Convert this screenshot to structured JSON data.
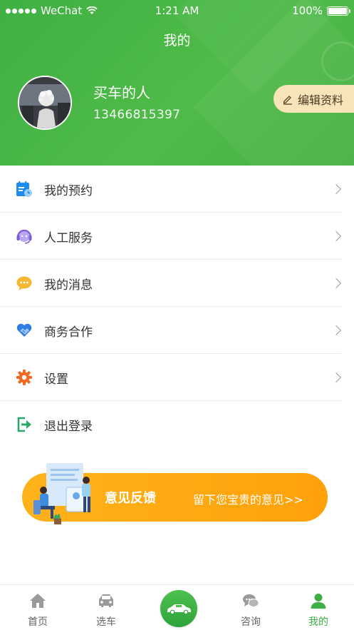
{
  "status_bar": {
    "carrier": "WeChat",
    "time": "1:21 AM",
    "battery": "100%"
  },
  "page": {
    "title": "我的"
  },
  "profile": {
    "name": "买车的人",
    "phone": "13466815397",
    "edit_label": "编辑资料"
  },
  "menu": {
    "items": [
      {
        "label": "我的预约",
        "icon": "calendar-icon",
        "color": "#1e8cf0",
        "chevron": true
      },
      {
        "label": "人工服务",
        "icon": "headset-icon",
        "color": "#7b5cd6",
        "chevron": true
      },
      {
        "label": "我的消息",
        "icon": "chat-bubble-icon",
        "color": "#f5a623",
        "chevron": true
      },
      {
        "label": "商务合作",
        "icon": "handshake-icon",
        "color": "#2f7de1",
        "chevron": true
      },
      {
        "label": "设置",
        "icon": "gear-icon",
        "color": "#f06a24",
        "chevron": true
      },
      {
        "label": "退出登录",
        "icon": "logout-icon",
        "color": "#2aa86a",
        "chevron": false
      }
    ]
  },
  "feedback_banner": {
    "title": "意见反馈",
    "subtitle": "留下您宝贵的意见>>"
  },
  "tabbar": {
    "tabs": [
      {
        "label": "首页",
        "icon": "home-icon",
        "active": false
      },
      {
        "label": "选车",
        "icon": "car-icon",
        "active": false
      },
      {
        "label": "",
        "icon": "car-center-icon",
        "active": false
      },
      {
        "label": "咨询",
        "icon": "chat-icon",
        "active": false
      },
      {
        "label": "我的",
        "icon": "person-icon",
        "active": true
      }
    ]
  },
  "colors": {
    "brand_green": "#45b243",
    "active_tab": "#3fae45",
    "banner_orange": "#ffa10a",
    "edit_button_bg": "#f7e4b8"
  }
}
